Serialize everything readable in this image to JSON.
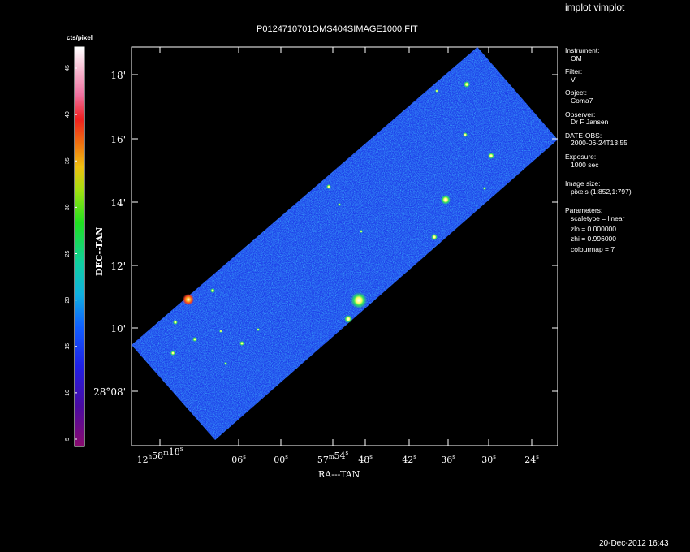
{
  "header": {
    "title": "implot vimplot"
  },
  "plot": {
    "title": "P0124710701OMS404SIMAGE1000.FIT",
    "xlabel": "RA---TAN",
    "ylabel": "DEC--TAN",
    "x_ticks": [
      {
        "main": "12",
        "sup1": "h",
        "mid": "58",
        "sup2": "m",
        "tail": "18",
        "sup3": "s"
      },
      {
        "main": "",
        "sup1": "",
        "mid": "",
        "sup2": "",
        "tail": "06",
        "sup3": "s"
      },
      {
        "main": "",
        "sup1": "",
        "mid": "",
        "sup2": "",
        "tail": "00",
        "sup3": "s"
      },
      {
        "main": "",
        "sup1": "",
        "mid": "57",
        "sup2": "m",
        "tail": "54",
        "sup3": "s"
      },
      {
        "main": "",
        "sup1": "",
        "mid": "",
        "sup2": "",
        "tail": "48",
        "sup3": "s"
      },
      {
        "main": "",
        "sup1": "",
        "mid": "",
        "sup2": "",
        "tail": "42",
        "sup3": "s"
      },
      {
        "main": "",
        "sup1": "",
        "mid": "",
        "sup2": "",
        "tail": "36",
        "sup3": "s"
      },
      {
        "main": "",
        "sup1": "",
        "mid": "",
        "sup2": "",
        "tail": "30",
        "sup3": "s"
      },
      {
        "main": "",
        "sup1": "",
        "mid": "",
        "sup2": "",
        "tail": "24",
        "sup3": "s"
      }
    ],
    "y_ticks": [
      "18'",
      "16'",
      "14'",
      "12'",
      "10'",
      "28°08'"
    ]
  },
  "colorbar": {
    "unit": "cts/pixel",
    "ticks": [
      "45",
      "40",
      "35",
      "30",
      "25",
      "20",
      "15",
      "10",
      "5"
    ]
  },
  "info": {
    "instrument_label": "Instrument:",
    "instrument": "OM",
    "filter_label": "Filter:",
    "filter": "V",
    "object_label": "Object:",
    "object": "Coma7",
    "observer_label": "Observer:",
    "observer": "Dr F Jansen",
    "date_label": "DATE-OBS:",
    "date": "2000-06-24T13:55",
    "exposure_label": "Exposure:",
    "exposure": "1000 sec",
    "size_label": "Image size:",
    "size": "pixels (1:852,1:797)",
    "params_label": "Parameters:",
    "param_scaletype": "scaletype = linear",
    "param_zlo": "zlo = 0.000000",
    "param_zhi": "zhi = 0.996000",
    "param_colourmap": "colourmap =    7"
  },
  "footer": {
    "timestamp": "20-Dec-2012 16:43"
  }
}
